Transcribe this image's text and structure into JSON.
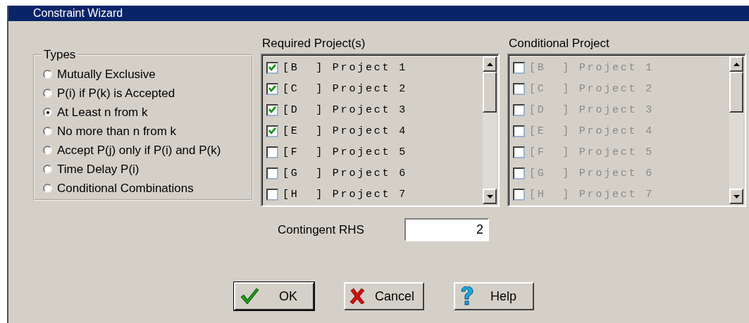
{
  "window": {
    "title": "Constraint Wizard"
  },
  "types": {
    "label": "Types",
    "options": [
      {
        "label": "Mutually Exclusive",
        "selected": false
      },
      {
        "label": "P(i) if P(k) is Accepted",
        "selected": false
      },
      {
        "label": "At Least n from k",
        "selected": true
      },
      {
        "label": "No more than n from k",
        "selected": false
      },
      {
        "label": "Accept P(j) only if P(i) and P(k)",
        "selected": false
      },
      {
        "label": "Time Delay P(i)",
        "selected": false
      },
      {
        "label": "Conditional Combinations",
        "selected": false
      }
    ]
  },
  "required_projects": {
    "label": "Required Project(s)",
    "disabled": false,
    "items": [
      {
        "label": "[B  ] Project 1",
        "checked": true
      },
      {
        "label": "[C  ] Project 2",
        "checked": true
      },
      {
        "label": "[D  ] Project 3",
        "checked": true
      },
      {
        "label": "[E  ] Project 4",
        "checked": true
      },
      {
        "label": "[F  ] Project 5",
        "checked": false
      },
      {
        "label": "[G  ] Project 6",
        "checked": false
      },
      {
        "label": "[H  ] Project 7",
        "checked": false
      }
    ]
  },
  "conditional_project": {
    "label": "Conditional Project",
    "disabled": true,
    "items": [
      {
        "label": "[B  ] Project 1",
        "checked": false
      },
      {
        "label": "[C  ] Project 2",
        "checked": false
      },
      {
        "label": "[D  ] Project 3",
        "checked": false
      },
      {
        "label": "[E  ] Project 4",
        "checked": false
      },
      {
        "label": "[F  ] Project 5",
        "checked": false
      },
      {
        "label": "[G  ] Project 6",
        "checked": false
      },
      {
        "label": "[H  ] Project 7",
        "checked": false
      }
    ]
  },
  "contingent_rhs": {
    "label": "Contingent RHS",
    "value": "2"
  },
  "buttons": [
    {
      "label": "OK",
      "kind": "ok",
      "default": true
    },
    {
      "label": "Cancel",
      "kind": "cancel",
      "default": false
    },
    {
      "label": "Help",
      "kind": "help",
      "default": false
    }
  ]
}
